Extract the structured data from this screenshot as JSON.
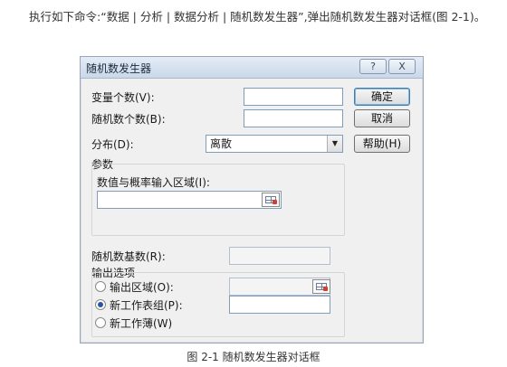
{
  "intro_text": "执行如下命令:“数据 | 分析 | 数据分析 | 随机数发生器”,弹出随机数发生器对话框(图 2-1)。",
  "dialog": {
    "title": "随机数发生器",
    "help_glyph": "?",
    "close_glyph": "X",
    "variables_label": "变量个数(V):",
    "variables_value": "",
    "count_label": "随机数个数(B):",
    "count_value": "",
    "distribution_label": "分布(D):",
    "distribution_value": "离散",
    "params_group_label": "参数",
    "params_input_label": "数值与概率输入区域(I):",
    "params_input_value": "",
    "seed_label": "随机数基数(R):",
    "seed_value": "",
    "output_group_label": "输出选项",
    "output_range_label": "输出区域(O):",
    "output_range_value": "",
    "new_sheet_label": "新工作表组(P):",
    "new_sheet_value": "",
    "new_book_label": "新工作薄(W)",
    "selected_output": "new_sheet",
    "ok_label": "确定",
    "cancel_label": "取消",
    "help_label": "帮助(H)"
  },
  "caption": "图 2-1 随机数发生器对话框",
  "colors": {
    "titlebar": "#c9d8ea",
    "dialog_bg": "#f0f0f0",
    "field_border": "#7f9db9"
  }
}
